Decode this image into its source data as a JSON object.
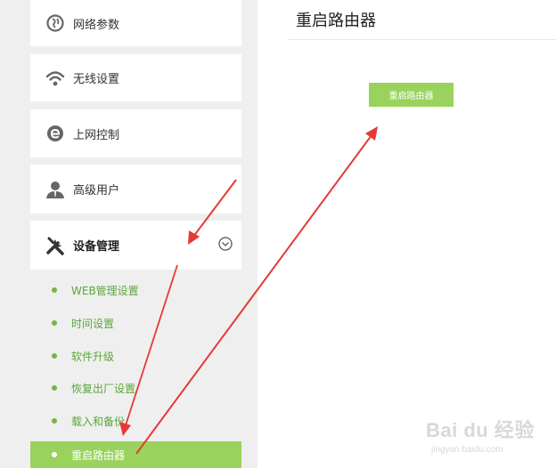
{
  "sidebar": {
    "items": [
      {
        "label": "网络参数",
        "icon": "globe-icon"
      },
      {
        "label": "无线设置",
        "icon": "wifi-icon"
      },
      {
        "label": "上网控制",
        "icon": "browser-e-icon"
      },
      {
        "label": "高级用户",
        "icon": "user-icon"
      },
      {
        "label": "设备管理",
        "icon": "tools-icon"
      }
    ],
    "submenu": [
      {
        "label": "WEB管理设置"
      },
      {
        "label": "时间设置"
      },
      {
        "label": "软件升级"
      },
      {
        "label": "恢复出厂设置"
      },
      {
        "label": "载入和备份"
      },
      {
        "label": "重启路由器"
      }
    ]
  },
  "main": {
    "title": "重启路由器",
    "reboot_button_label": "重启路由器"
  },
  "watermark": {
    "brand": "Bai du 经验",
    "url": "jingyan.baidu.com"
  },
  "colors": {
    "accent": "#99d35d",
    "submenu_text": "#5aa83a",
    "arrow": "#e53935",
    "sidebar_bg": "#efefef"
  }
}
